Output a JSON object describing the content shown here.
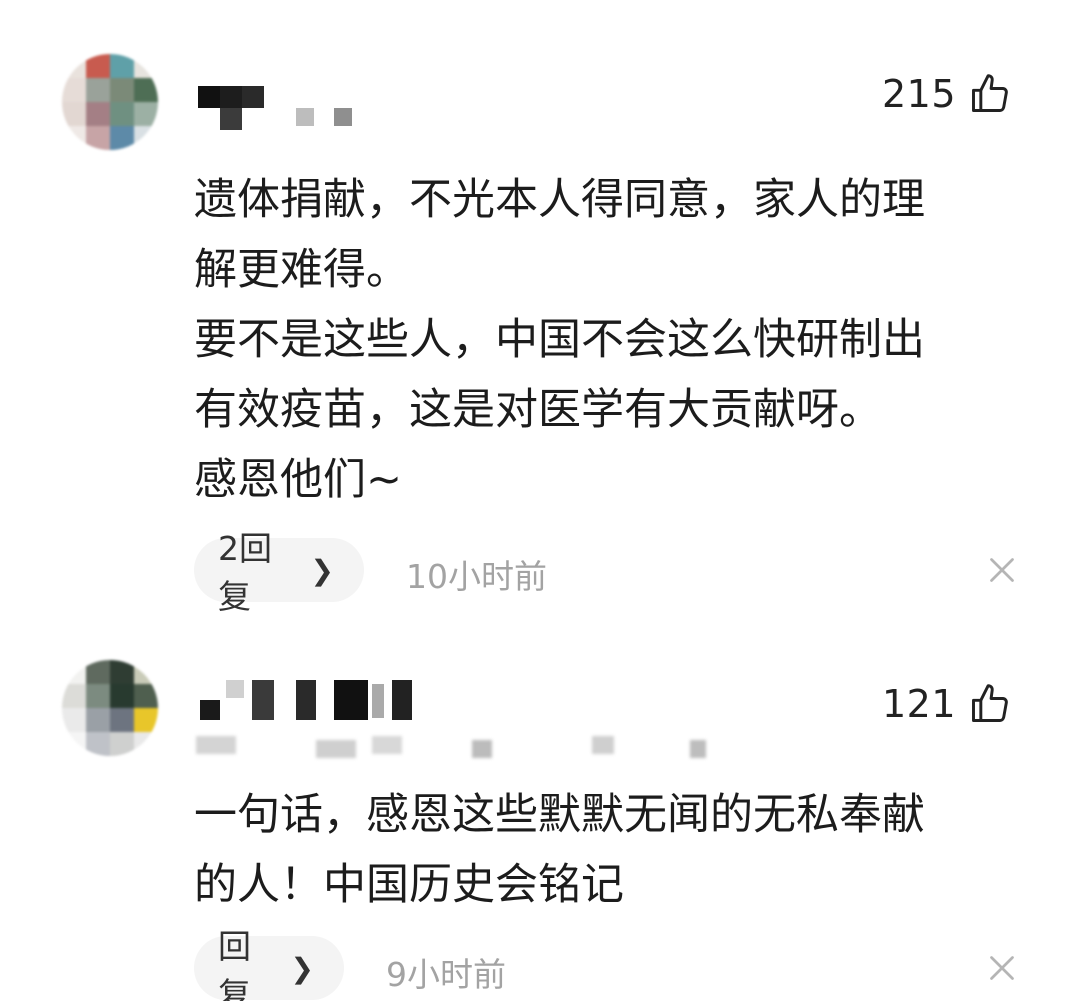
{
  "comments": [
    {
      "likes": "215",
      "body": "遗体捐献，不光本人得同意，家人的理\n解更难得。\n要不是这些人，中国不会这么快研制出\n有效疫苗，这是对医学有大贡献呀。\n感恩他们~",
      "reply_label": "2回复",
      "time": "10小时前"
    },
    {
      "likes": "121",
      "body": "一句话，感恩这些默默无闻的无私奉献\n的人！中国历史会铭记",
      "reply_label": "回复",
      "time": "9小时前"
    }
  ],
  "icons": {
    "like": "thumbs-up-icon",
    "reply_chevron": "chevron-right-icon",
    "dismiss": "close-icon"
  },
  "colors": {
    "text": "#1c1c1c",
    "muted": "#a3a3a3",
    "pill_bg": "#f4f4f4"
  }
}
